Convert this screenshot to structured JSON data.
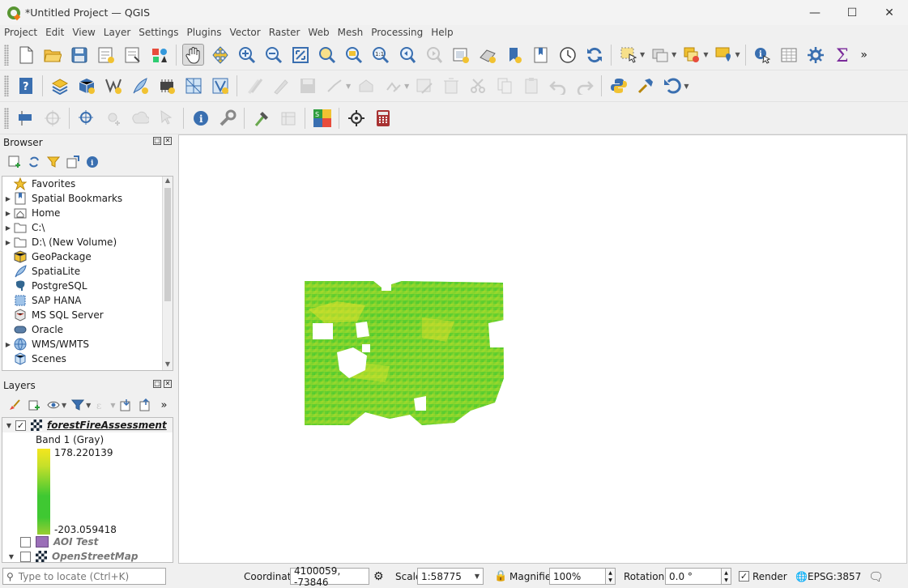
{
  "window": {
    "title": "*Untitled Project — QGIS"
  },
  "menu": [
    "Project",
    "Edit",
    "View",
    "Layer",
    "Settings",
    "Plugins",
    "Vector",
    "Raster",
    "Web",
    "Mesh",
    "Processing",
    "Help"
  ],
  "browser": {
    "title": "Browser",
    "items": [
      {
        "label": "Favorites",
        "icon": "star-icon",
        "expandable": false
      },
      {
        "label": "Spatial Bookmarks",
        "icon": "bookmarks-icon",
        "expandable": true
      },
      {
        "label": "Home",
        "icon": "home-folder-icon",
        "expandable": true
      },
      {
        "label": "C:\\",
        "icon": "folder-icon",
        "expandable": true
      },
      {
        "label": "D:\\ (New Volume)",
        "icon": "folder-icon",
        "expandable": true
      },
      {
        "label": "GeoPackage",
        "icon": "geopackage-icon",
        "expandable": false
      },
      {
        "label": "SpatiaLite",
        "icon": "spatialite-icon",
        "expandable": false
      },
      {
        "label": "PostgreSQL",
        "icon": "postgresql-icon",
        "expandable": false
      },
      {
        "label": "SAP HANA",
        "icon": "sap-hana-icon",
        "expandable": false
      },
      {
        "label": "MS SQL Server",
        "icon": "mssql-icon",
        "expandable": false
      },
      {
        "label": "Oracle",
        "icon": "oracle-icon",
        "expandable": false
      },
      {
        "label": "WMS/WMTS",
        "icon": "wms-globe-icon",
        "expandable": true
      },
      {
        "label": "Scenes",
        "icon": "scenes-icon",
        "expandable": false
      }
    ]
  },
  "layers": {
    "title": "Layers",
    "raster": {
      "name": "forestFireAssessment",
      "band": "Band 1 (Gray)",
      "max": "178.220139",
      "min": "-203.059418",
      "checked": true
    },
    "others": [
      {
        "name": "AOI Test",
        "checked": false,
        "swatch": "#9b6fb8"
      },
      {
        "name": "OpenStreetMap",
        "checked": false
      }
    ]
  },
  "status": {
    "locate_placeholder": "Type to locate (Ctrl+K)",
    "coordinate_label": "Coordinate",
    "coordinate_value": "4100059, -73846",
    "scale_label": "Scale",
    "scale_value": "1:58775",
    "magnifier_label": "Magnifier",
    "magnifier_value": "100%",
    "rotation_label": "Rotation",
    "rotation_value": "0.0 °",
    "render_label": "Render",
    "render_checked": true,
    "crs": "EPSG:3857"
  },
  "colors": {
    "qgis_green": "#589632",
    "ramp_top": "#f4e61e",
    "ramp_mid": "#3fc832",
    "ramp_bottom": "#9acd32"
  }
}
